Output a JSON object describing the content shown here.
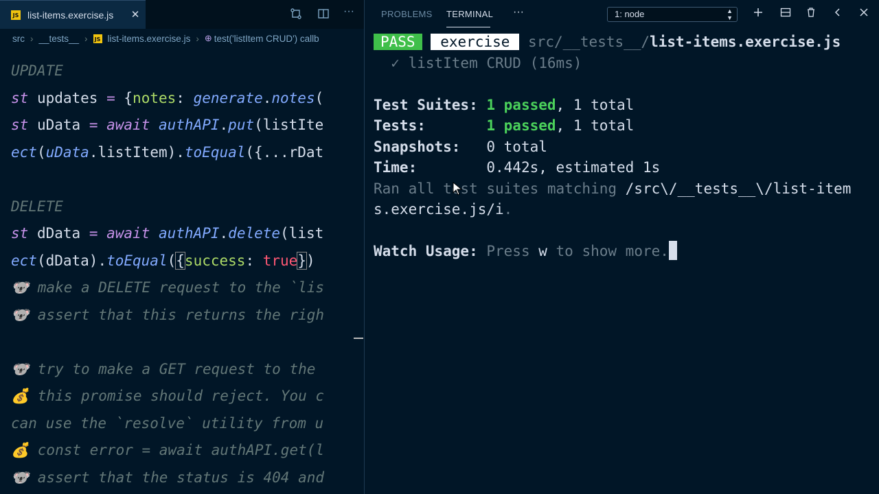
{
  "editor": {
    "tab": {
      "icon": "js-file-icon",
      "label": "list-items.exercise.js",
      "close": "✕"
    },
    "breadcrumb": [
      "src",
      "__tests__",
      "list-items.exercise.js",
      "test('listItem CRUD') callb"
    ],
    "code_lines": [
      {
        "parts": [
          [
            "cmt",
            "UPDATE"
          ]
        ]
      },
      {
        "parts": [
          [
            "kw",
            "st"
          ],
          [
            "var",
            " updates "
          ],
          [
            "op",
            "="
          ],
          [
            "punc",
            " {"
          ],
          [
            "prop",
            "notes"
          ],
          [
            "punc",
            ": "
          ],
          [
            "fnc",
            "generate"
          ],
          [
            "punc",
            "."
          ],
          [
            "fnc",
            "notes"
          ],
          [
            "punc",
            "("
          ]
        ]
      },
      {
        "parts": [
          [
            "kw",
            "st"
          ],
          [
            "var",
            " uData "
          ],
          [
            "op",
            "="
          ],
          [
            "punc",
            " "
          ],
          [
            "kw",
            "await"
          ],
          [
            "punc",
            " "
          ],
          [
            "fnc",
            "authAPI"
          ],
          [
            "punc",
            "."
          ],
          [
            "fnc",
            "put"
          ],
          [
            "punc",
            "(listIte"
          ]
        ]
      },
      {
        "parts": [
          [
            "fnc",
            "ect"
          ],
          [
            "punc",
            "("
          ],
          [
            "fnc",
            "uData"
          ],
          [
            "punc",
            ".listItem)."
          ],
          [
            "fnc",
            "toEqual"
          ],
          [
            "punc",
            "({...rDat"
          ]
        ]
      },
      {
        "parts": [
          [
            "var",
            " "
          ]
        ]
      },
      {
        "parts": [
          [
            "cmt",
            "DELETE"
          ]
        ]
      },
      {
        "parts": [
          [
            "kw",
            "st"
          ],
          [
            "var",
            " dData "
          ],
          [
            "op",
            "="
          ],
          [
            "punc",
            " "
          ],
          [
            "kw",
            "await"
          ],
          [
            "punc",
            " "
          ],
          [
            "fnc",
            "authAPI"
          ],
          [
            "punc",
            "."
          ],
          [
            "fnc",
            "delete"
          ],
          [
            "punc",
            "(list"
          ]
        ]
      },
      {
        "parts": [
          [
            "fnc",
            "ect"
          ],
          [
            "punc",
            "(dData)."
          ],
          [
            "fnc",
            "toEqual"
          ],
          [
            "punc",
            "("
          ],
          [
            "hl",
            "{"
          ],
          [
            "prop",
            "success"
          ],
          [
            "punc",
            ": "
          ],
          [
            "bool",
            "true"
          ],
          [
            "hl",
            "}"
          ],
          [
            "punc",
            ")"
          ]
        ]
      },
      {
        "parts": [
          [
            "cmt",
            "🐨 make a DELETE request to the `lis"
          ]
        ]
      },
      {
        "parts": [
          [
            "cmt",
            "🐨 assert that this returns the righ"
          ]
        ]
      },
      {
        "parts": [
          [
            "var",
            " "
          ]
        ]
      },
      {
        "parts": [
          [
            "cmt",
            "🐨 try to make a GET request to the"
          ]
        ]
      },
      {
        "parts": [
          [
            "cmt",
            "💰 this promise should reject. You c"
          ]
        ]
      },
      {
        "parts": [
          [
            "cmt",
            "can use the `resolve` utility from u"
          ]
        ]
      },
      {
        "parts": [
          [
            "cmt",
            "💰 const error = await authAPI.get(l"
          ]
        ]
      },
      {
        "parts": [
          [
            "cmt",
            "🐨 assert that the status is 404 and"
          ]
        ]
      }
    ]
  },
  "panel": {
    "tabs": {
      "problems": "PROBLEMS",
      "terminal": "TERMINAL",
      "more": "···"
    },
    "terminal_select": "1: node",
    "icons": [
      "plus-icon",
      "split-icon",
      "trash-icon",
      "chevron-left-icon",
      "close-icon"
    ]
  },
  "terminal": {
    "pass_badge": "PASS",
    "exercise_badge": "exercise",
    "path_dim": "src/__tests__/",
    "path_file": "list-items.exercise.js",
    "test_line": "  ✓ listItem CRUD (16ms)",
    "suites_label": "Test Suites: ",
    "suites_passed": "1 passed",
    "suites_total": ", 1 total",
    "tests_label": "Tests:       ",
    "tests_passed": "1 passed",
    "tests_total": ", 1 total",
    "snapshots_label": "Snapshots:   ",
    "snapshots_value": "0 total",
    "time_label": "Time:        ",
    "time_value": "0.442s, estimated 1s",
    "ran_dim": "Ran all test suites matching ",
    "ran_pattern_1": "/src\\/__tests__\\/list-item",
    "ran_pattern_2": "s.exercise.js/i",
    "ran_end": ".",
    "watch_label": "Watch Usage: ",
    "watch_dim_1": "Press ",
    "watch_key": "w",
    "watch_dim_2": " to show more."
  }
}
